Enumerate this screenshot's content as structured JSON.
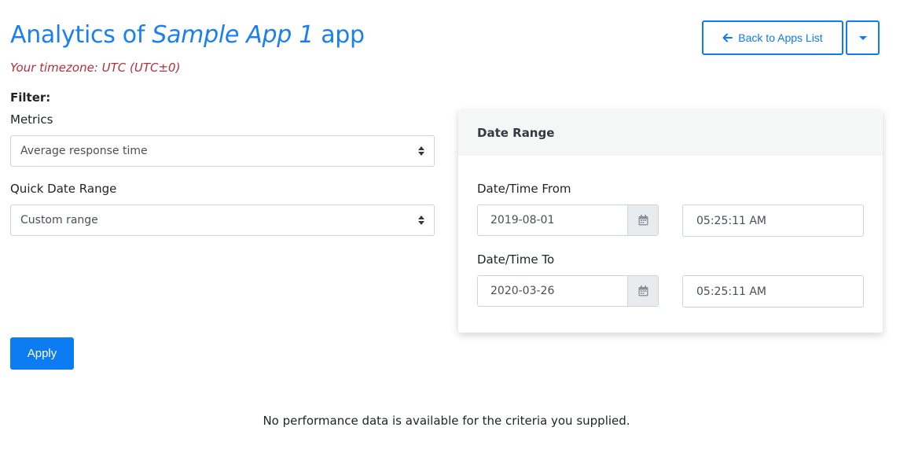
{
  "header": {
    "title_prefix": "Analytics of ",
    "app_name": "Sample App 1",
    "title_suffix": " app",
    "timezone": "Your timezone: UTC (UTC±0)",
    "back_button_label": "Back to Apps List",
    "back_icon": "arrow-left-icon",
    "dropdown_icon": "caret-down-icon"
  },
  "filter": {
    "heading": "Filter:",
    "metrics_label": "Metrics",
    "metrics_value": "Average response time",
    "quick_range_label": "Quick Date Range",
    "quick_range_value": "Custom range",
    "apply_label": "Apply"
  },
  "date_range": {
    "heading": "Date Range",
    "from_label": "Date/Time From",
    "from_date": "2019-08-01",
    "from_time": "05:25:11 AM",
    "to_label": "Date/Time To",
    "to_date": "2020-03-26",
    "to_time": "05:25:11 AM",
    "calendar_icon": "calendar-icon"
  },
  "message": "No performance data is available for the criteria you supplied.",
  "colors": {
    "primary": "#0d7bf2",
    "title": "#1a7ff0",
    "timezone": "#b0303f",
    "card_header_bg": "#f5f6f6"
  }
}
